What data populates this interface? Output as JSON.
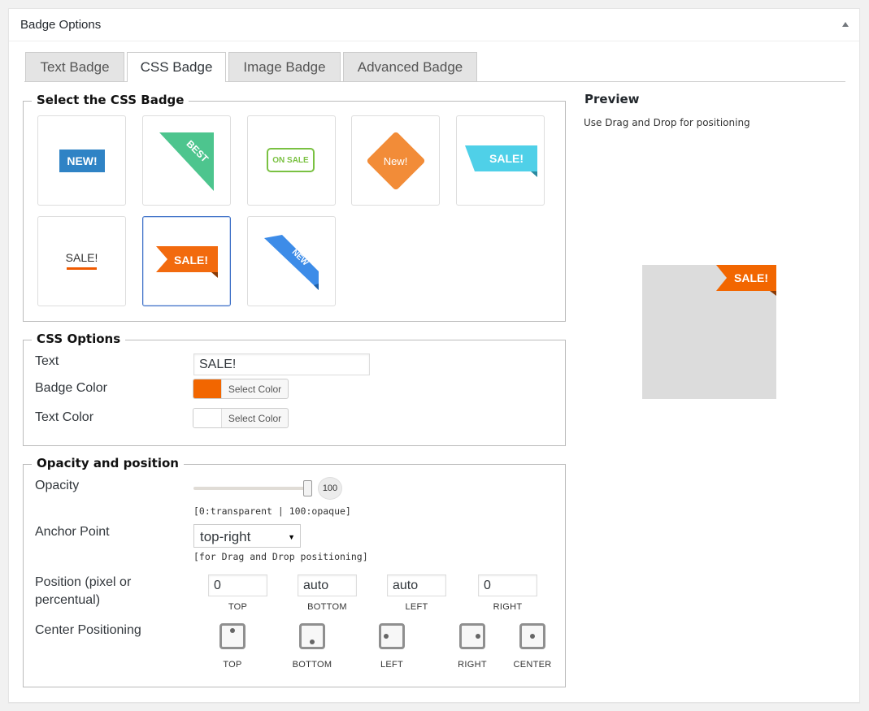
{
  "panel": {
    "title": "Badge Options"
  },
  "tabs": [
    {
      "label": "Text Badge",
      "active": false
    },
    {
      "label": "CSS Badge",
      "active": true
    },
    {
      "label": "Image Badge",
      "active": false
    },
    {
      "label": "Advanced Badge",
      "active": false
    }
  ],
  "select_badge": {
    "legend": "Select the CSS Badge",
    "badges": [
      {
        "text": "NEW!",
        "color": "#2f83c5"
      },
      {
        "text": "BEST",
        "color": "#4dc58e"
      },
      {
        "text": "ON SALE",
        "color": "#7ac142"
      },
      {
        "text": "New!",
        "color": "#f28c38"
      },
      {
        "text": "SALE!",
        "color": "#4fd0e8"
      },
      {
        "text": "SALE!",
        "color": "#f05a00"
      },
      {
        "text": "SALE!",
        "color": "#f26a0e",
        "selected": true
      },
      {
        "text": "NEW",
        "color": "#3d8ce8"
      }
    ]
  },
  "css_options": {
    "legend": "CSS Options",
    "text_label": "Text",
    "text_value": "SALE!",
    "badge_color_label": "Badge Color",
    "badge_color": "#f26600",
    "text_color_label": "Text Color",
    "text_color": "#ffffff",
    "select_color_label": "Select Color"
  },
  "opacity_position": {
    "legend": "Opacity and position",
    "opacity_label": "Opacity",
    "opacity_value": "100",
    "opacity_hint": "[0:transparent | 100:opaque]",
    "anchor_label": "Anchor Point",
    "anchor_value": "top-right",
    "anchor_hint": "[for Drag and Drop positioning]",
    "position_label": "Position (pixel or percentual)",
    "position": [
      {
        "value": "0",
        "caption": "TOP"
      },
      {
        "value": "auto",
        "caption": "BOTTOM"
      },
      {
        "value": "auto",
        "caption": "LEFT"
      },
      {
        "value": "0",
        "caption": "RIGHT"
      }
    ],
    "center_label": "Center Positioning",
    "center_options": [
      "TOP",
      "BOTTOM",
      "LEFT",
      "RIGHT",
      "CENTER"
    ]
  },
  "preview": {
    "title": "Preview",
    "subtitle": "Use Drag and Drop for positioning",
    "badge_text": "SALE!",
    "badge_color": "#f26600",
    "badge_text_color": "#ffffff"
  }
}
